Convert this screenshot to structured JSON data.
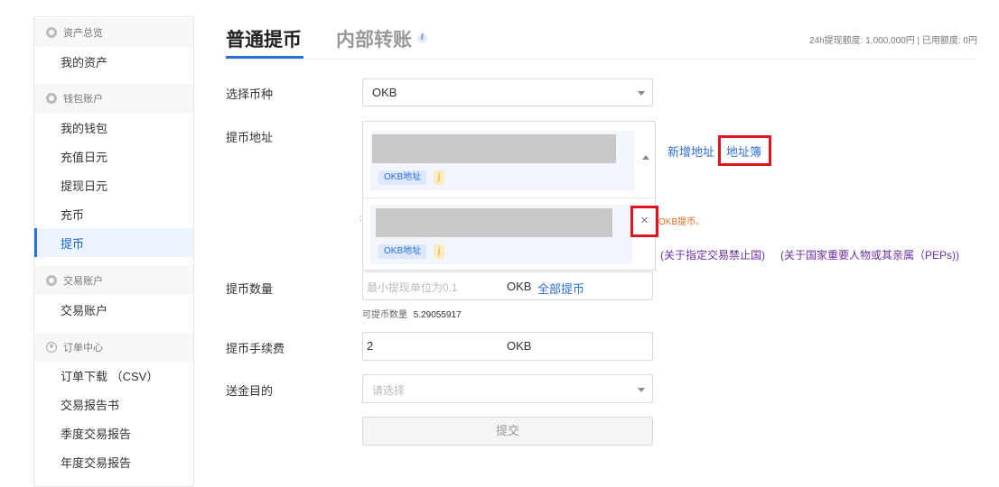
{
  "sidebar": {
    "sections": [
      {
        "title": "资产总览",
        "items": [
          "我的资产"
        ]
      },
      {
        "title": "钱包账户",
        "items": [
          "我的钱包",
          "充值日元",
          "提现日元",
          "充币",
          "提币"
        ]
      },
      {
        "title": "交易账户",
        "items": [
          "交易账户"
        ]
      },
      {
        "title": "订单中心",
        "items": [
          "订单下载 （CSV）",
          "交易报告书",
          "季度交易报告",
          "年度交易报告"
        ]
      }
    ],
    "active_item": "提币"
  },
  "tabs": {
    "active": "普通提币",
    "inactive": "内部转账",
    "info_icon": "i"
  },
  "limit_text": "24h提现额度: 1,000,000円 | 已用额度: 0円",
  "form": {
    "coin_label": "选择币种",
    "coin_value": "OKB",
    "address_label": "提币地址",
    "address_tag_type": "OKB地址",
    "address_tag_short": "j",
    "new_address_link": "新增地址",
    "address_book_link": "地址簿",
    "close_symbol": "×",
    "partial_notice": "OKB提币。",
    "compliance_links": [
      "(关于指定交易禁止国)",
      "(关于国家重要人物或其亲属（PEPs))"
    ],
    "amount_label": "提币数量",
    "amount_placeholder": "最小提现单位为0.1",
    "amount_unit": "OKB",
    "withdraw_all": "全部提币",
    "available_label": "可提币数量",
    "available_value": "5.29055917",
    "fee_label": "提币手续费",
    "fee_value": "2",
    "fee_unit": "OKB",
    "purpose_label": "送金目的",
    "purpose_placeholder": "请选择",
    "submit_label": "提交"
  },
  "colors": {
    "accent": "#2d6fdb",
    "highlight": "#e0141e",
    "warning": "#e86b1f",
    "compliance": "#6b2fa6"
  }
}
